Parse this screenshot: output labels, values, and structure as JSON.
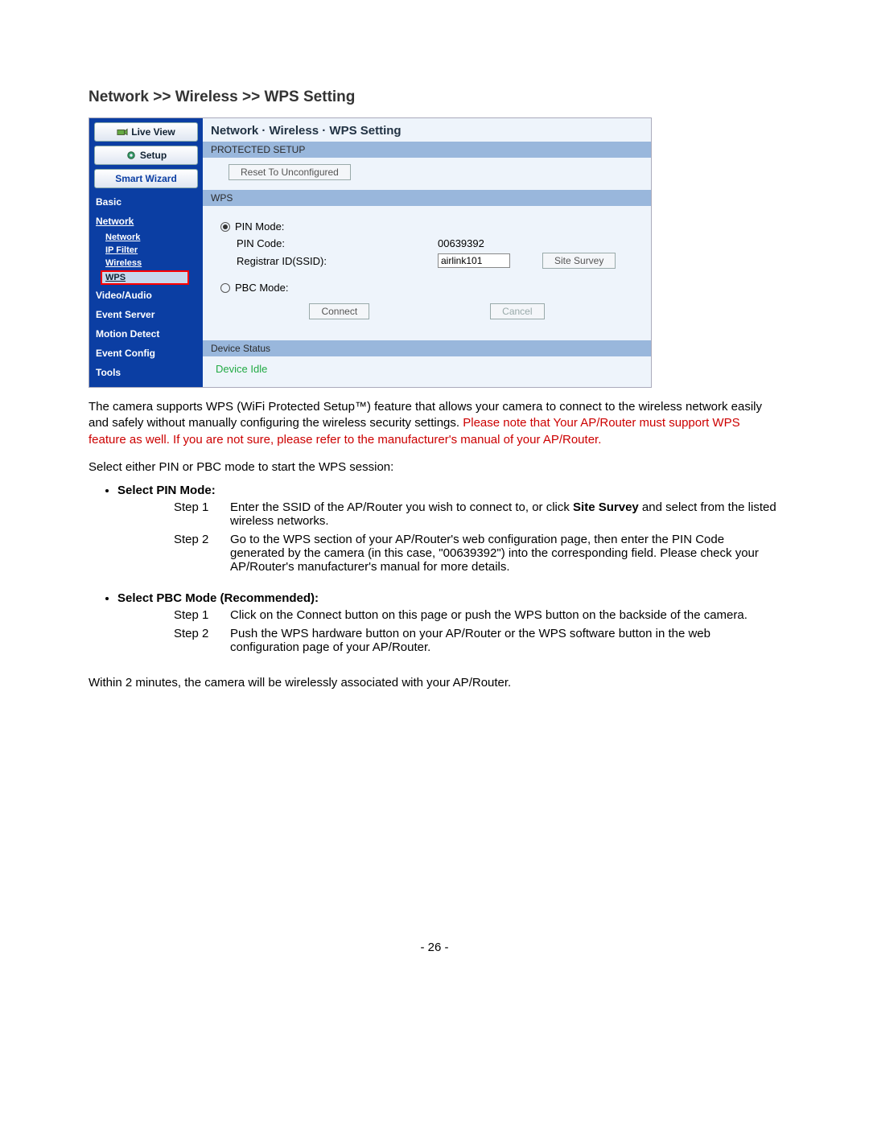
{
  "page": {
    "title": "Network >> Wireless >> WPS Setting",
    "number": "- 26 -"
  },
  "ui": {
    "sidebar": {
      "live_view": "Live View",
      "setup": "Setup",
      "smart_wizard": "Smart Wizard",
      "items": {
        "basic": "Basic",
        "network": "Network",
        "network_sub": "Network",
        "ip_filter": "IP Filter",
        "wireless": "Wireless",
        "wps": "WPS",
        "video_audio": "Video/Audio",
        "event_server": "Event Server",
        "motion_detect": "Motion Detect",
        "event_config": "Event Config",
        "tools": "Tools"
      }
    },
    "content": {
      "title": "Network · Wireless  · WPS Setting",
      "protected_setup": "PROTECTED SETUP",
      "reset_btn": "Reset To Unconfigured",
      "wps_header": "WPS",
      "pin_mode_label": "PIN Mode:",
      "pin_code_label": "PIN Code:",
      "pin_code_value": "00639392",
      "registrar_label": "Registrar ID(SSID):",
      "registrar_value": "airlink101",
      "site_survey_btn": "Site Survey",
      "pbc_mode_label": "PBC Mode:",
      "connect_btn": "Connect",
      "cancel_btn": "Cancel",
      "device_status_header": "Device Status",
      "device_status_value": "Device Idle"
    }
  },
  "doc": {
    "p1a": "The camera supports WPS (WiFi Protected Setup™) feature that allows your camera to connect to the wireless network easily and safely without manually configuring the wireless security settings. ",
    "p1b": "Please note that Your AP/Router must support WPS feature as well. If you are not sure, please refer to the manufacturer's manual of your AP/Router.",
    "p2": "Select either PIN or PBC mode to start the WPS session:",
    "pin_title": "Select PIN Mode:",
    "pin_s1_label": "Step 1",
    "pin_s1_a": "Enter the SSID of the AP/Router you wish to connect to, or click ",
    "pin_s1_b": "Site Survey",
    "pin_s1_c": " and select from the listed wireless networks.",
    "pin_s2_label": "Step 2",
    "pin_s2": "Go to the WPS section of your AP/Router's web configuration page, then enter the PIN Code generated by the camera (in this case, \"00639392\") into the corresponding field. Please check your AP/Router's manufacturer's manual for more details.",
    "pbc_title": "Select PBC Mode (Recommended):",
    "pbc_s1_label": "Step 1",
    "pbc_s1": "Click on the Connect button on this page or push the WPS button on the backside of the camera.",
    "pbc_s2_label": "Step 2",
    "pbc_s2": "Push the WPS hardware button on your AP/Router or the WPS software button in the web configuration page of your AP/Router.",
    "p3": "Within 2 minutes, the camera will be wirelessly associated with your AP/Router."
  }
}
